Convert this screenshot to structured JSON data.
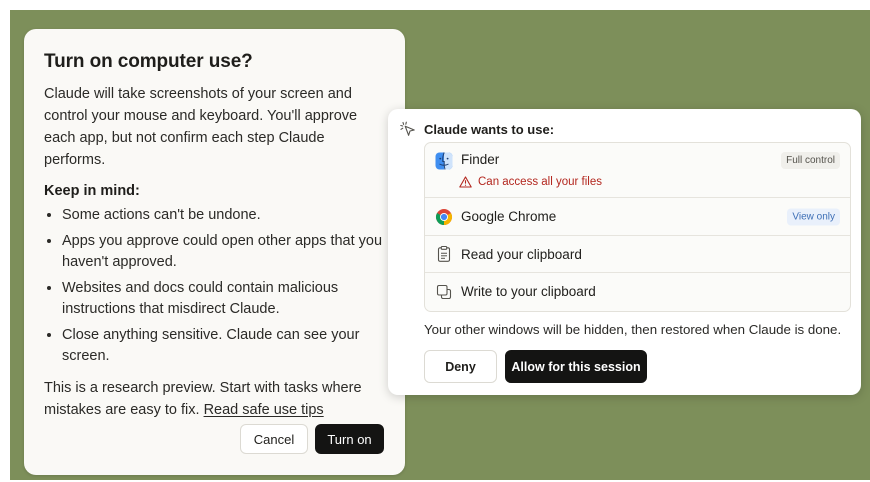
{
  "dialog": {
    "title": "Turn on computer use?",
    "intro": "Claude will take screenshots of your screen and control your mouse and keyboard. You'll approve each app, but not confirm each step Claude performs.",
    "keep_in_mind_heading": "Keep in mind:",
    "bullets": [
      "Some actions can't be undone.",
      "Apps you approve could open other apps that you haven't approved.",
      "Websites and docs could contain malicious instructions that misdirect Claude.",
      "Close anything sensitive. Claude can see your screen."
    ],
    "outro": "This is a research preview. Start with tasks where mistakes are easy to fix.",
    "safe_use_link": "Read safe use tips",
    "cancel_label": "Cancel",
    "turn_on_label": "Turn on"
  },
  "panel": {
    "header_icon": "sparkle-cursor-icon",
    "title": "Claude wants to use:",
    "items": [
      {
        "icon": "finder-icon",
        "label": "Finder",
        "badge": "Full control",
        "warning": "Can access all your files",
        "warning_icon": "warning-triangle-icon"
      },
      {
        "icon": "chrome-icon",
        "label": "Google Chrome",
        "badge": "View only"
      },
      {
        "icon": "clipboard-icon",
        "label": "Read your clipboard"
      },
      {
        "icon": "copy-icon",
        "label": "Write to your clipboard"
      }
    ],
    "note": "Your other windows will be hidden, then restored when Claude is done.",
    "deny_label": "Deny",
    "allow_label": "Allow for this session"
  },
  "colors": {
    "desktop_background": "#7d8f5a",
    "primary_button": "#141413",
    "warning": "#b3261e",
    "view_only_badge": "#3e6fb6"
  }
}
